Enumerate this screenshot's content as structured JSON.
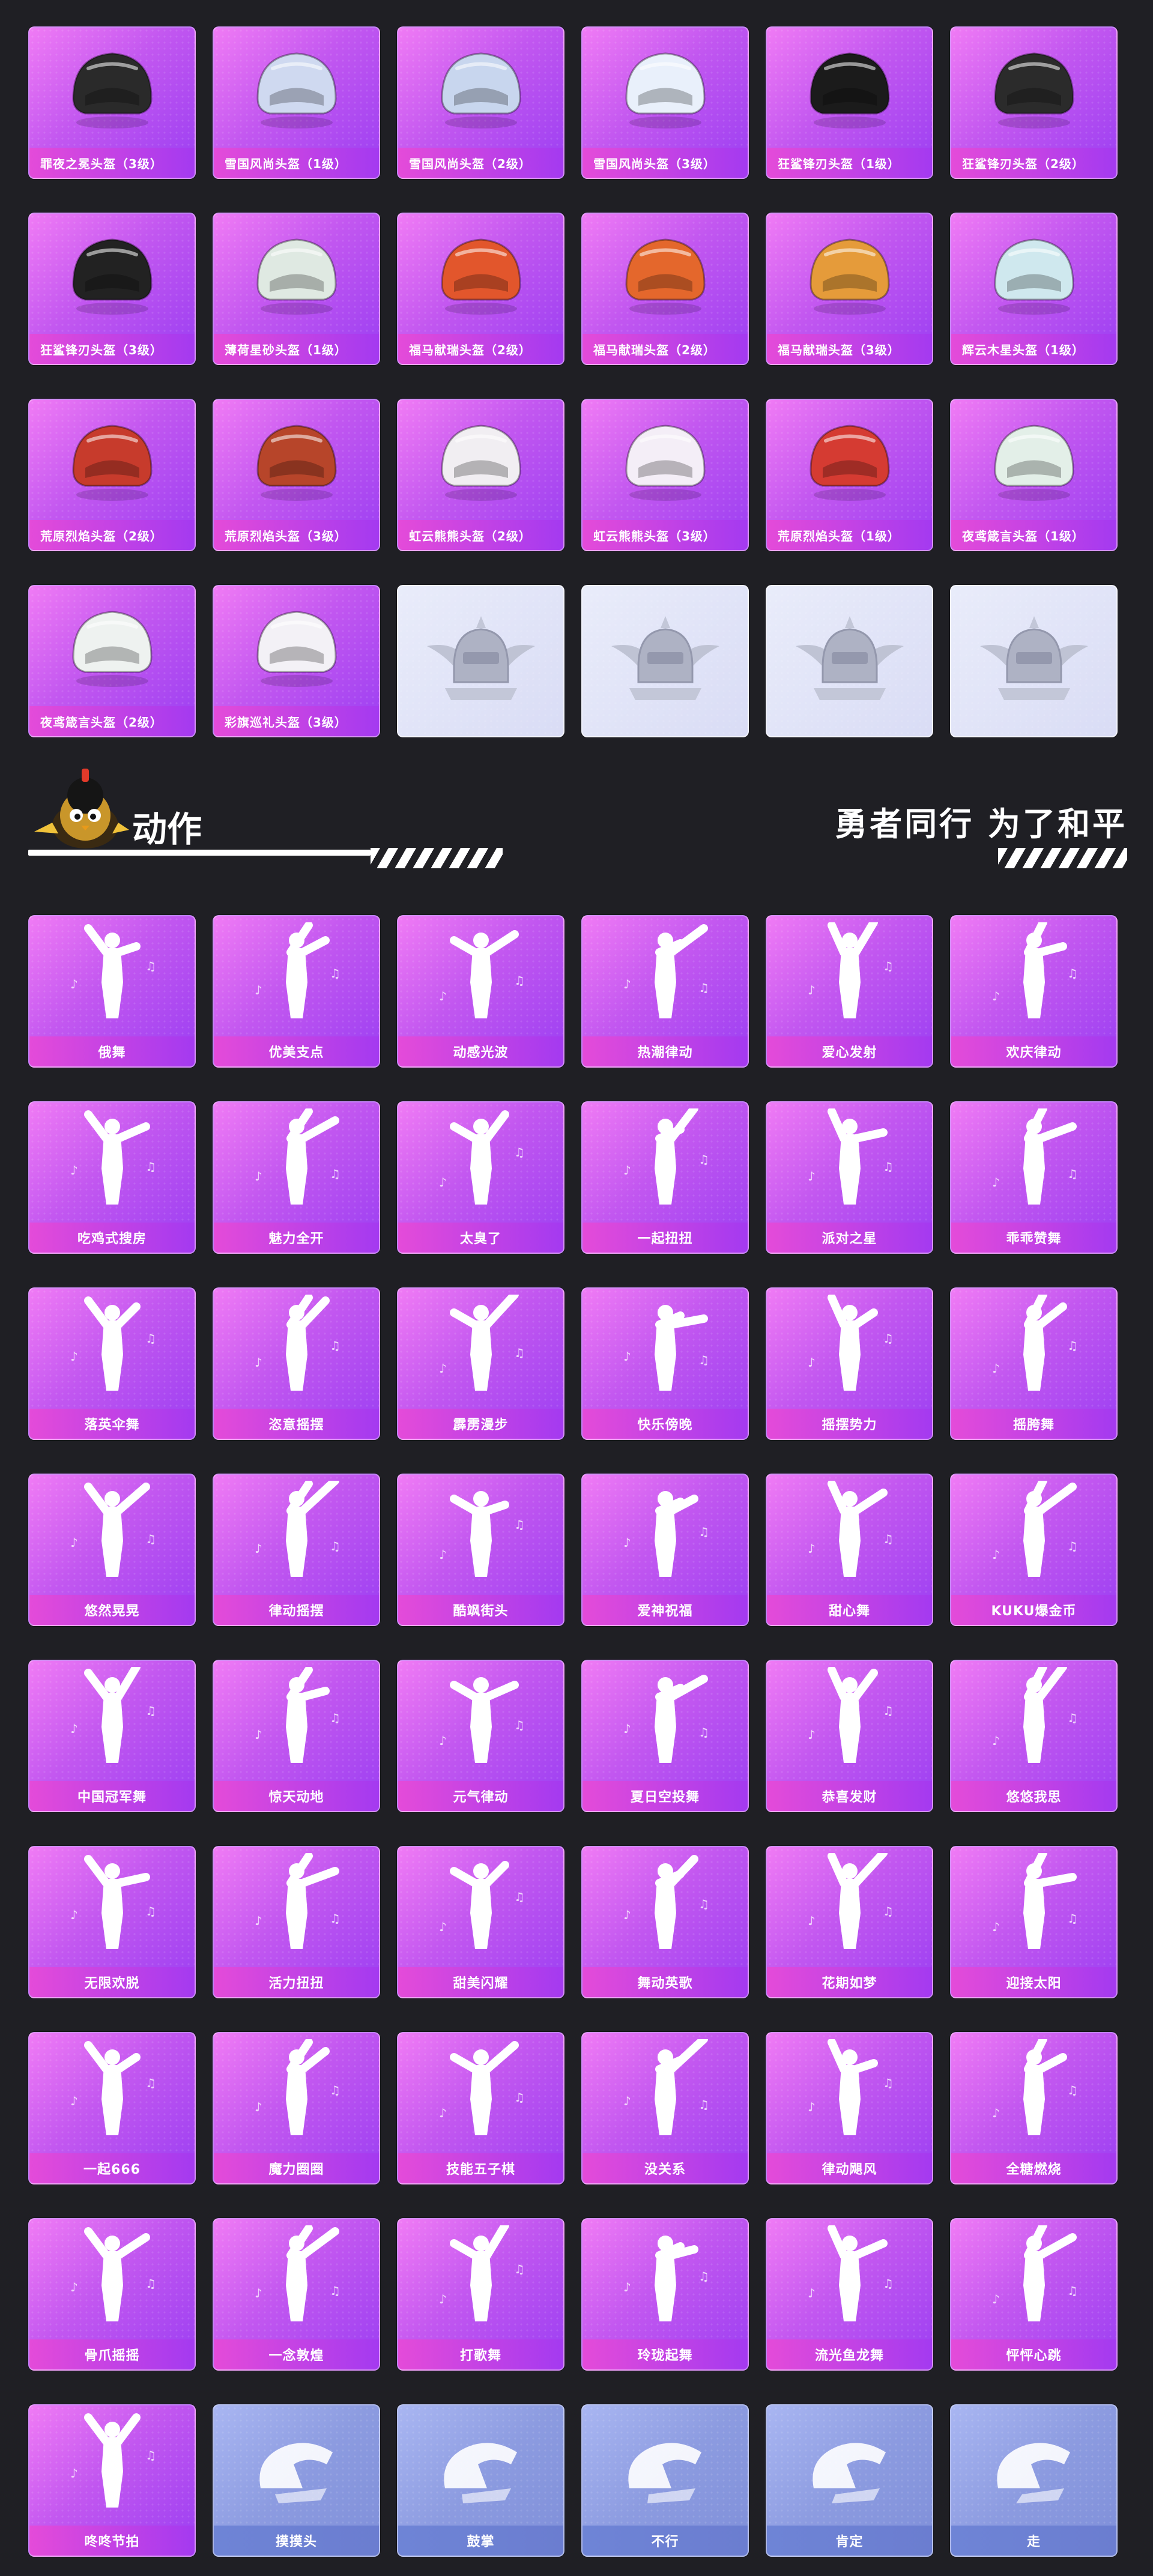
{
  "helmets": [
    [
      "罪夜之冕头盔（3级）",
      "雪国风尚头盔（1级）",
      "雪国风尚头盔（2级）",
      "雪国风尚头盔（3级）",
      "狂鲨锋刃头盔（1级）",
      "狂鲨锋刃头盔（2级）"
    ],
    [
      "狂鲨锋刃头盔（3级）",
      "薄荷星砂头盔（1级）",
      "福马献瑞头盔（2级）",
      "福马献瑞头盔（2级）",
      "福马献瑞头盔（3级）",
      "辉云木星头盔（1级）"
    ],
    [
      "荒原烈焰头盔（2级）",
      "荒原烈焰头盔（3级）",
      "虹云熊熊头盔（2级）",
      "虹云熊熊头盔（3级）",
      "荒原烈焰头盔（1级）",
      "夜鸢箴言头盔（1级）"
    ],
    [
      "夜鸢箴言头盔（2级）",
      "彩旗巡礼头盔（3级）"
    ]
  ],
  "section": {
    "title": "动作",
    "slogan": "勇者同行 为了和平"
  },
  "emotes": [
    [
      "俄舞",
      "优美支点",
      "动感光波",
      "热潮律动",
      "爱心发射",
      "欢庆律动"
    ],
    [
      "吃鸡式搜房",
      "魅力全开",
      "太臭了",
      "一起扭扭",
      "派对之星",
      "乖乖赞舞"
    ],
    [
      "落英伞舞",
      "恣意摇摆",
      "霹雳漫步",
      "快乐傍晚",
      "摇摆势力",
      "摇胯舞"
    ],
    [
      "悠然晃晃",
      "律动摇摆",
      "酷飒街头",
      "爱神祝福",
      "甜心舞",
      "KUKU爆金币"
    ],
    [
      "中国冠军舞",
      "惊天动地",
      "元气律动",
      "夏日空投舞",
      "恭喜发财",
      "悠悠我思"
    ],
    [
      "无限欢脱",
      "活力扭扭",
      "甜美闪耀",
      "舞动英歌",
      "花期如梦",
      "迎接太阳"
    ],
    [
      "一起666",
      "魔力圈圈",
      "技能五子棋",
      "没关系",
      "律动飓风",
      "全糖燃烧"
    ],
    [
      "骨爪摇摇",
      "一念敦煌",
      "打歌舞",
      "玲珑起舞",
      "流光鱼龙舞",
      "怦怦心跳"
    ],
    [
      "咚咚节拍",
      "摸摸头",
      "鼓掌",
      "不行",
      "肯定",
      "走"
    ]
  ],
  "colors": {
    "background": "#1f1f24",
    "card_purple": "#c257f0",
    "card_blue": "#8c9be0",
    "label_pink": "#e44bd9"
  }
}
